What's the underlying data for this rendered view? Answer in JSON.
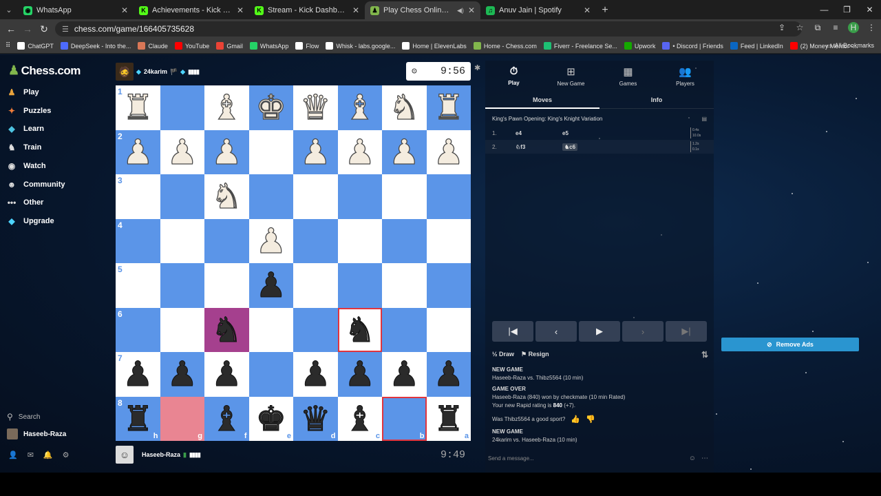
{
  "browser": {
    "tabs": [
      {
        "title": "WhatsApp",
        "icon": "whatsapp-icon",
        "color": "#25d366",
        "glyph": "◉",
        "active": false
      },
      {
        "title": "Achievements - Kick Dashboard",
        "icon": "kick-icon",
        "color": "#53fc18",
        "glyph": "K",
        "active": false
      },
      {
        "title": "Stream - Kick Dashboard",
        "icon": "kick-icon",
        "color": "#53fc18",
        "glyph": "K",
        "active": false
      },
      {
        "title": "Play Chess Online for FREE",
        "icon": "chess-icon",
        "color": "#81b64c",
        "glyph": "♟",
        "active": true
      },
      {
        "title": "Anuv Jain | Spotify",
        "icon": "spotify-icon",
        "color": "#1db954",
        "glyph": "♫",
        "active": false
      }
    ],
    "url": "chess.com/game/166405735628",
    "bookmarks": [
      {
        "label": "ChatGPT",
        "icon": "chatgpt-icon",
        "color": "#ffffff"
      },
      {
        "label": "DeepSeek - Into the...",
        "icon": "deepseek-icon",
        "color": "#4d6bfe"
      },
      {
        "label": "Claude",
        "icon": "claude-icon",
        "color": "#d97757"
      },
      {
        "label": "YouTube",
        "icon": "youtube-icon",
        "color": "#ff0000"
      },
      {
        "label": "Gmail",
        "icon": "gmail-icon",
        "color": "#ea4335"
      },
      {
        "label": "WhatsApp",
        "icon": "whatsapp-icon",
        "color": "#25d366"
      },
      {
        "label": "Flow",
        "icon": "folder-icon",
        "color": "#ffffff"
      },
      {
        "label": "Whisk - labs.google...",
        "icon": "whisk-icon",
        "color": "#ffffff"
      },
      {
        "label": "Home | ElevenLabs",
        "icon": "folder-icon",
        "color": "#ffffff"
      },
      {
        "label": "Home - Chess.com",
        "icon": "chess-icon",
        "color": "#81b64c"
      },
      {
        "label": "Fiverr - Freelance Se...",
        "icon": "fiverr-icon",
        "color": "#1dbf73"
      },
      {
        "label": "Upwork",
        "icon": "upwork-icon",
        "color": "#14a800"
      },
      {
        "label": "• Discord | Friends",
        "icon": "discord-icon",
        "color": "#5865f2"
      },
      {
        "label": "Feed | LinkedIn",
        "icon": "linkedin-icon",
        "color": "#0a66c2"
      },
      {
        "label": "(2) Money Mentor -...",
        "icon": "youtube-icon",
        "color": "#ff0000"
      }
    ],
    "all_bookmarks": "All Bookmarks"
  },
  "sidebar": {
    "logo": "Chess.com",
    "items": [
      {
        "label": "Play",
        "icon": "play-icon",
        "glyph": "♟",
        "color": "#e8a33c"
      },
      {
        "label": "Puzzles",
        "icon": "puzzle-icon",
        "glyph": "✦",
        "color": "#f07d3a"
      },
      {
        "label": "Learn",
        "icon": "learn-icon",
        "glyph": "◆",
        "color": "#4dc3e0"
      },
      {
        "label": "Train",
        "icon": "train-icon",
        "glyph": "♞",
        "color": "#dddddd"
      },
      {
        "label": "Watch",
        "icon": "watch-icon",
        "glyph": "◉",
        "color": "#dddddd"
      },
      {
        "label": "Community",
        "icon": "community-icon",
        "glyph": "☻",
        "color": "#dddddd"
      },
      {
        "label": "Other",
        "icon": "more-icon",
        "glyph": "•••",
        "color": "#dddddd"
      },
      {
        "label": "Upgrade",
        "icon": "diamond-icon",
        "glyph": "◆",
        "color": "#4dd4ff"
      }
    ],
    "search": "Search",
    "user": "Haseeb-Raza"
  },
  "game": {
    "top_player": {
      "name": "24karim",
      "flag": "🏴",
      "clock": "9:56"
    },
    "bottom_player": {
      "name": "Haseeb-Raza",
      "clock": "9:49"
    },
    "board": {
      "rank_labels": [
        "1",
        "2",
        "3",
        "4",
        "5",
        "6",
        "7",
        "8"
      ],
      "file_labels": [
        "h",
        "g",
        "f",
        "e",
        "d",
        "c",
        "b",
        "a"
      ],
      "rows": [
        [
          "wR",
          "",
          "wB",
          "wK",
          "wQ",
          "wB",
          "wN",
          "wR"
        ],
        [
          "wP",
          "wP",
          "wP",
          "",
          "wP",
          "wP",
          "wP",
          "wP"
        ],
        [
          "",
          "",
          "wN",
          "",
          "",
          "",
          "",
          ""
        ],
        [
          "",
          "",
          "",
          "wP",
          "",
          "",
          "",
          ""
        ],
        [
          "",
          "",
          "",
          "bP",
          "",
          "",
          "",
          ""
        ],
        [
          "",
          "",
          "bN",
          "",
          "",
          "bN",
          "",
          ""
        ],
        [
          "bP",
          "bP",
          "bP",
          "",
          "bP",
          "bP",
          "bP",
          "bP"
        ],
        [
          "bR",
          "",
          "bB",
          "bK",
          "bQ",
          "bB",
          "",
          "bR"
        ]
      ],
      "highlight_selected": "c6",
      "highlight_last_from": "g8",
      "premove_square": "b8",
      "premove_target": "c6",
      "colors": {
        "light": "#ffffff",
        "dark": "#5b95e8",
        "selected": "#a5408e",
        "last_move": "#e98592",
        "outline": "#e0343d"
      }
    }
  },
  "panel": {
    "tabs": [
      {
        "label": "Play",
        "icon": "stopwatch-icon",
        "glyph": "⏱"
      },
      {
        "label": "New Game",
        "icon": "plus-square-icon",
        "glyph": "⊞"
      },
      {
        "label": "Games",
        "icon": "grid-icon",
        "glyph": "▦"
      },
      {
        "label": "Players",
        "icon": "players-icon",
        "glyph": "👥"
      }
    ],
    "subtabs": [
      "Moves",
      "Info"
    ],
    "opening": "King's Pawn Opening: King's Knight Variation",
    "moves": [
      {
        "num": "1.",
        "white": "e4",
        "black": "e5",
        "t1": "0.4s",
        "t2": "10.0s"
      },
      {
        "num": "2.",
        "white": "♘f3",
        "black": "♞c6",
        "t1": "1.2s",
        "t2": "0.1s"
      }
    ],
    "draw": "Draw",
    "resign": "Resign",
    "log": {
      "new_game_1": "NEW GAME",
      "match_1": "Haseeb-Raza vs. Thibz5564 (10 min)",
      "game_over": "GAME OVER",
      "result": "Haseeb-Raza (840) won by checkmate (10 min Rated)",
      "rating_prefix": "Your new Rapid rating is ",
      "rating_value": "840",
      "rating_suffix": " (+7).",
      "sport_question": "Was Thibz5564 a good sport?",
      "new_game_2": "NEW GAME",
      "match_2": "24karim vs. Haseeb-Raza (10 min)"
    },
    "chat_placeholder": "Send a message..."
  },
  "remove_ads": "Remove Ads"
}
